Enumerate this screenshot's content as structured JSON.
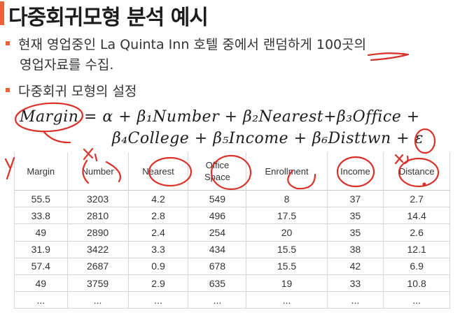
{
  "title": "다중회귀모형 분석 예시",
  "bullets": {
    "b1_pre": "현재 영업중인 La Quinta Inn 호텔 중에서 랜덤하게 ",
    "b1_highlight": "100곳",
    "b1_post": "의",
    "b1_line2": "영업자료를 수집.",
    "b2": "다중회귀 모형의 설정"
  },
  "formula": {
    "line1": "Margin  =  α + β₁Number + β₂Nearest+β₃Office  +",
    "line2": "β₄College  + β₅Income  + β₆Disttwn + ε"
  },
  "annotations": {
    "y": "y",
    "x1": "x₁",
    "x6": "x₆"
  },
  "colors": {
    "accent": "#e9643b",
    "ink": "#d9322b"
  },
  "table": {
    "headers": [
      "Margin",
      "Number",
      "Nearest",
      "Office Space",
      "Enrollment",
      "Income",
      "Distance"
    ],
    "rows": [
      [
        "55.5",
        "3203",
        "4.2",
        "549",
        "8",
        "37",
        "2.7"
      ],
      [
        "33.8",
        "2810",
        "2.8",
        "496",
        "17.5",
        "35",
        "14.4"
      ],
      [
        "49",
        "2890",
        "2.4",
        "254",
        "20",
        "35",
        "2.6"
      ],
      [
        "31.9",
        "3422",
        "3.3",
        "434",
        "15.5",
        "38",
        "12.1"
      ],
      [
        "57.4",
        "2687",
        "0.9",
        "678",
        "15.5",
        "42",
        "6.9"
      ],
      [
        "49",
        "3759",
        "2.9",
        "635",
        "19",
        "33",
        "10.8"
      ],
      [
        "...",
        "...",
        "...",
        "...",
        "...",
        "...",
        "..."
      ]
    ]
  }
}
